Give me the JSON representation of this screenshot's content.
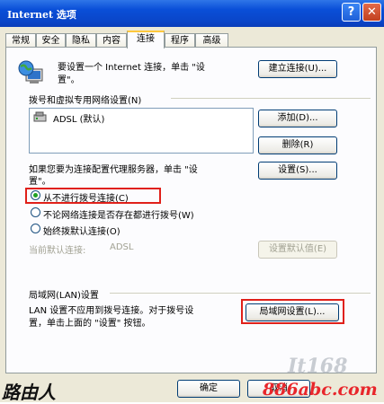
{
  "window": {
    "title": "Internet 选项",
    "help": "?",
    "close": "✕"
  },
  "tabs": [
    {
      "label": "常规"
    },
    {
      "label": "安全"
    },
    {
      "label": "隐私"
    },
    {
      "label": "内容"
    },
    {
      "label": "连接"
    },
    {
      "label": "程序"
    },
    {
      "label": "高级"
    }
  ],
  "active_tab": "连接",
  "setup": {
    "text_line1": "要设置一个 Internet 连接，单击 \"设",
    "text_line2": "置\"。",
    "button": "建立连接(U)..."
  },
  "dialup": {
    "group_label": "拨号和虚拟专用网络设置(N)",
    "items": [
      {
        "label": "ADSL (默认)"
      }
    ],
    "add_button": "添加(D)...",
    "remove_button": "删除(R)",
    "proxy_text_line1": "如果您要为连接配置代理服务器，单击 \"设",
    "proxy_text_line2": "置\"。",
    "settings_button": "设置(S)...",
    "options": [
      {
        "label": "从不进行拨号连接(C)",
        "selected": true
      },
      {
        "label": "不论网络连接是否存在都进行拨号(W)",
        "selected": false
      },
      {
        "label": "始终拨默认连接(O)",
        "selected": false
      }
    ],
    "current_default_label": "当前默认连接:",
    "current_default_value": "ADSL",
    "set_default_button": "设置默认值(E)"
  },
  "lan": {
    "group_label": "局域网(LAN)设置",
    "text_line1": "LAN 设置不应用到拨号连接。对于拨号设",
    "text_line2": "置，单击上面的 \"设置\" 按钮。",
    "button": "局域网设置(L)..."
  },
  "footer": {
    "ok": "确定",
    "cancel": "取消"
  },
  "watermarks": {
    "left": "路由人",
    "right": "886abc.com",
    "logo": "It168"
  },
  "colors": {
    "titlebar": "#0A4FD8",
    "highlight": "#E0201A",
    "dialog_bg": "#ECE9D8"
  }
}
